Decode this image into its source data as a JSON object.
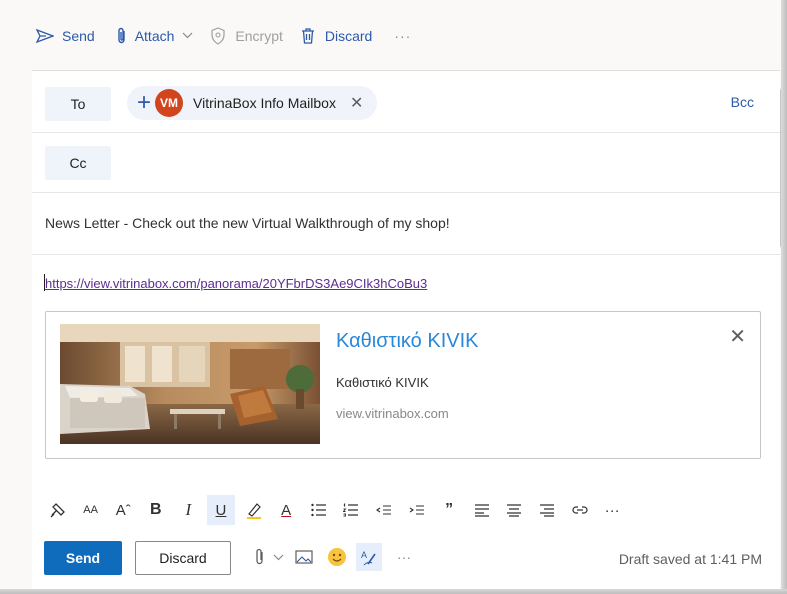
{
  "top_bar": {
    "send_label": "Send",
    "attach_label": "Attach",
    "encrypt_label": "Encrypt",
    "discard_label": "Discard",
    "more_label": "···"
  },
  "to_field": {
    "label": "To",
    "recipient_initials": "VM",
    "recipient_name": "VitrinaBox Info Mailbox",
    "remove_label": "✕",
    "bcc_label": "Bcc"
  },
  "cc_field": {
    "label": "Cc"
  },
  "subject": "News Letter - Check out the new Virtual Walkthrough of my shop!",
  "body": {
    "link": "https://view.vitrinabox.com/panorama/20YFbrDS3Ae9CIk3hCoBu3"
  },
  "link_preview": {
    "title": "Καθιστικό KIVIK",
    "description": "Καθιστικό KIVIK",
    "domain": "view.vitrinabox.com",
    "close_label": "✕"
  },
  "format_toolbar": {
    "font_size_label": "AΑ",
    "grow_label": "Aˆ",
    "bold_label": "B",
    "italic_label": "I",
    "underline_label": "U",
    "font_color_label": "A",
    "quote_label": "”",
    "more_label": "···"
  },
  "actions": {
    "send_label": "Send",
    "discard_label": "Discard",
    "more_label": "···",
    "status": "Draft saved at 1:41 PM"
  },
  "colors": {
    "accent": "#0f6cbd",
    "link_blue": "#2b5aa8",
    "avatar": "#d2441d",
    "preview_title": "#2b88d8"
  }
}
